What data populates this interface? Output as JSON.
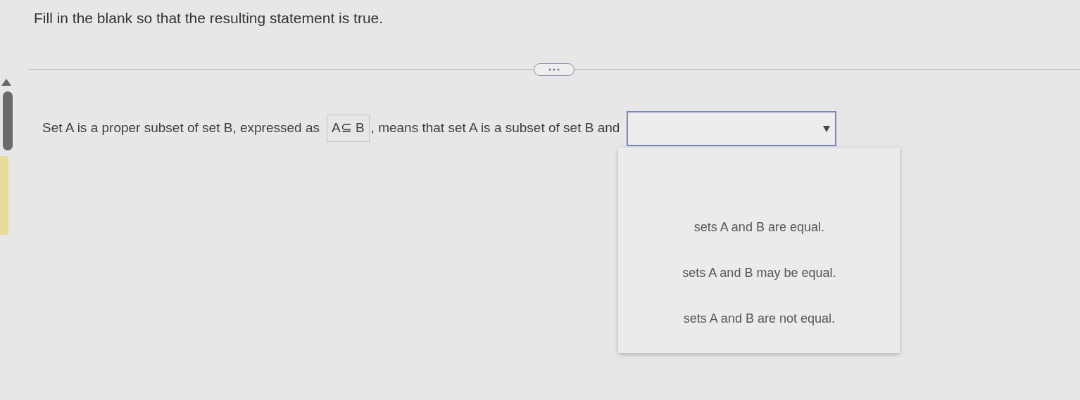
{
  "instruction": "Fill in the blank so that the resulting statement is true.",
  "statement": {
    "before": "Set A is a proper subset of set B, expressed as",
    "expression": "A⊆ B",
    "after": ", means that set A is a subset of set B and"
  },
  "dropdown": {
    "expanded": true,
    "options": [
      {
        "label": "sets A and B are equal.",
        "selected": false
      },
      {
        "label": "sets A and B may be equal.",
        "selected": false
      },
      {
        "label": "sets A and B are not equal.",
        "selected": false
      }
    ]
  }
}
